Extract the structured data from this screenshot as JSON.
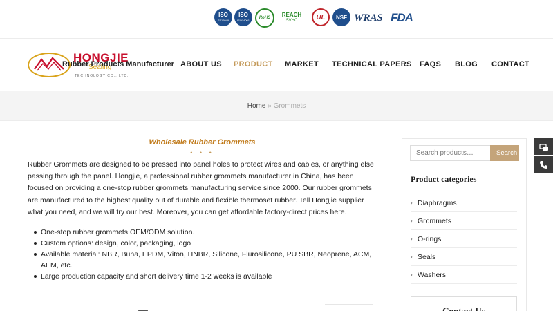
{
  "certifications": {
    "iso16949": {
      "label": "ISO",
      "sub": "TS16949"
    },
    "iso14001": {
      "label": "ISO",
      "sub": "ISO14001"
    },
    "rohs": "RoHS",
    "reach": {
      "label": "REACH",
      "sub": "SVHC"
    },
    "ul": "UL",
    "nsf": "NSF",
    "wras": "WRAS",
    "fda": "FDA"
  },
  "brand": {
    "name": "HONGJIE",
    "sub": "Sealing",
    "tagline": "Rubber Products Manufacturer",
    "company": "TECHNOLOGY CO., LTD."
  },
  "nav": {
    "items": [
      {
        "label": "ABOUT US"
      },
      {
        "label": "PRODUCT"
      },
      {
        "label": "MARKET"
      },
      {
        "label": "TECHNICAL PAPERS"
      },
      {
        "label": "FAQS"
      },
      {
        "label": "BLOG"
      },
      {
        "label": "CONTACT"
      }
    ],
    "active_color": "#c49a5a"
  },
  "breadcrumb": {
    "home": "Home",
    "separator": "»",
    "current": "Grommets"
  },
  "main": {
    "title": "Wholesale Rubber Grommets",
    "dots": "• • •",
    "intro": "Rubber Grommets are designed to be pressed into panel holes to protect wires and cables, or anything else passing through the panel. Hongjie, a professional rubber grommets manufacturer in China, has been focused on providing a one-stop rubber grommets manufacturing service since 2000. Our rubber grommets are manufactured to the highest quality out of durable and flexible thermoset rubber. Tell Hongjie supplier what you need, and we will try our best. Moreover, you can get affordable factory-direct prices here.",
    "bullets": [
      "One-stop rubber grommets OEM/ODM solution.",
      "Custom options: design, color, packaging, logo",
      "Available material: NBR, Buna, EPDM, Viton, HNBR, Silicone, Flurosilicone, PU SBR, Neoprene, ACM, AEM, etc.",
      "Large production capacity and short delivery time 1-2 weeks is available"
    ]
  },
  "sidebar": {
    "search": {
      "placeholder": "Search products…",
      "button": "Search"
    },
    "categories_heading": "Product categories",
    "categories": [
      {
        "label": "Diaphragms"
      },
      {
        "label": "Grommets"
      },
      {
        "label": "O-rings"
      },
      {
        "label": "Seals"
      },
      {
        "label": "Washers"
      }
    ],
    "contact_heading": "Contact Us"
  },
  "floating": {
    "icons": [
      "message-icon",
      "phone-icon"
    ]
  },
  "colors": {
    "accent": "#c49a5a",
    "title_orange": "#c07a1a",
    "brand_red": "#c8102e",
    "brand_gold": "#d9a31a",
    "band_gray": "#f4f4f4"
  }
}
